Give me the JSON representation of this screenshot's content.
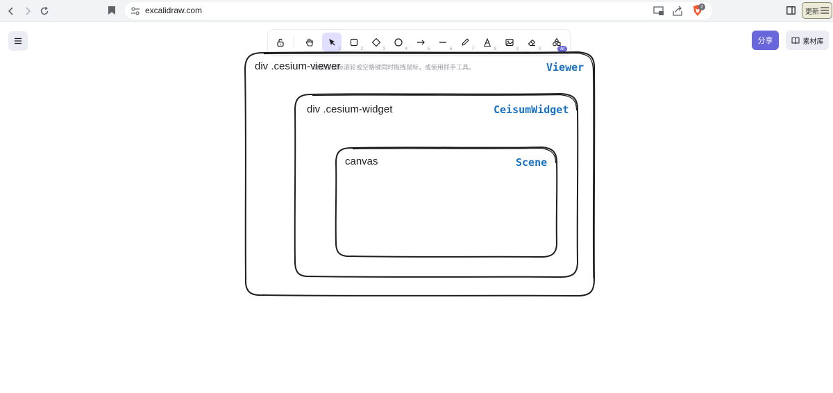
{
  "browser": {
    "url": "excalidraw.com",
    "update_label": "更新",
    "brave_count": "2"
  },
  "toolbar": {
    "tools": [
      {
        "name": "hand",
        "key": ""
      },
      {
        "name": "selection",
        "key": "1"
      },
      {
        "name": "rectangle",
        "key": "2"
      },
      {
        "name": "diamond",
        "key": "3"
      },
      {
        "name": "ellipse",
        "key": "4"
      },
      {
        "name": "arrow",
        "key": "5"
      },
      {
        "name": "line",
        "key": "6"
      },
      {
        "name": "draw",
        "key": "7"
      },
      {
        "name": "text",
        "key": "8"
      },
      {
        "name": "image",
        "key": "9"
      },
      {
        "name": "eraser",
        "key": "0"
      }
    ],
    "ai_badge": "AI"
  },
  "header": {
    "share_label": "分享",
    "library_label": "素材库"
  },
  "hint": "请按住鼠标滚轮或空格键同时拖拽鼠标，或使用抓手工具。",
  "drawing": {
    "viewer": {
      "label": "div  .cesium-viewer",
      "name": "Viewer"
    },
    "widget": {
      "label": "div  .cesium-widget",
      "name": "CeisumWidget"
    },
    "scene": {
      "label": "canvas",
      "name": "Scene"
    }
  }
}
